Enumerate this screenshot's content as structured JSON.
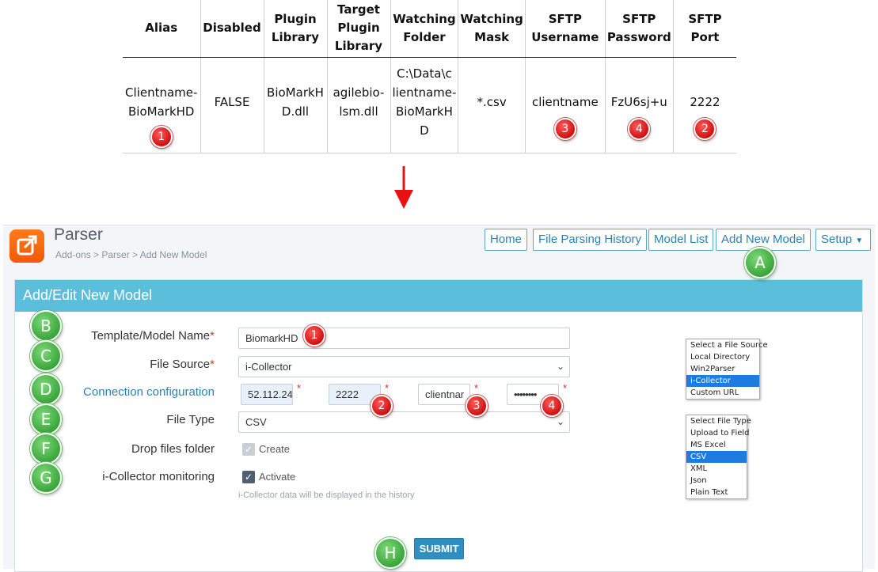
{
  "table": {
    "headers": [
      "Alias",
      "Disabled",
      "Plugin Library",
      "Target Plugin Library",
      "Watching Folder",
      "Watching Mask",
      "SFTP Username",
      "SFTP Password",
      "SFTP Port"
    ],
    "header_lines": [
      [
        "Alias"
      ],
      [
        "Disabled"
      ],
      [
        "Plugin",
        "Library"
      ],
      [
        "Target",
        "Plugin",
        "Library"
      ],
      [
        "Watching",
        "Folder"
      ],
      [
        "Watching",
        "Mask"
      ],
      [
        "SFTP",
        "Username"
      ],
      [
        "SFTP",
        "Password"
      ],
      [
        "SFTP Port"
      ]
    ],
    "row": [
      [
        "Clientname-",
        "BioMarkHD"
      ],
      [
        "FALSE"
      ],
      [
        "BioMarkH",
        "D.dll"
      ],
      [
        "agilebio-",
        "lsm.dll"
      ],
      [
        "C:\\Data\\c",
        "lientname-",
        "BioMarkH",
        "D"
      ],
      [
        "*.csv"
      ],
      [
        "clientname"
      ],
      [
        "FzU6sj+u"
      ],
      [
        "2222"
      ]
    ],
    "badges": {
      "alias": "1",
      "username": "3",
      "password": "4",
      "port": "2"
    }
  },
  "app": {
    "title": "Parser",
    "breadcrumb": "Add-ons > Parser > Add New Model",
    "nav": {
      "home": "Home",
      "history": "File Parsing History",
      "model_list": "Model List",
      "add_new": "Add New Model",
      "setup": "Setup"
    },
    "panel_title": "Add/Edit New Model",
    "labels": {
      "template": "Template/Model Name",
      "file_source": "File Source",
      "connection": "Connection configuration",
      "file_type": "File Type",
      "drop_folder": "Drop files folder",
      "monitoring": "i-Collector monitoring"
    },
    "values": {
      "template": "BiomarkHD",
      "file_source": "i-Collector",
      "host": "52.112.24",
      "port": "2222",
      "username": "clientnar",
      "password": "••••••••",
      "file_type": "CSV"
    },
    "checkboxes": {
      "create": "Create",
      "create_checked": true,
      "activate": "Activate",
      "activate_checked": true
    },
    "hint": "i-Collector data will be displayed in the history",
    "submit": "SUBMIT"
  },
  "dropdown_file_source": {
    "options": [
      "Select a File Source",
      "Local Directory",
      "Win2Parser",
      "i-Collector",
      "Custom URL"
    ],
    "selected": "i-Collector"
  },
  "dropdown_file_type": {
    "options": [
      "Select File Type",
      "Upload to Field",
      "MS Excel",
      "CSV",
      "XML",
      "Json",
      "Plain Text"
    ],
    "selected": "CSV"
  },
  "step_badges": [
    "A",
    "B",
    "C",
    "D",
    "E",
    "F",
    "G",
    "H"
  ],
  "form_badges": {
    "template": "1",
    "port": "2",
    "username": "3",
    "password": "4"
  },
  "colors": {
    "accent": "#5bbfdc",
    "nav_border": "#5aa7c7",
    "red": "#d01010",
    "green": "#3aa63a",
    "submit": "#2f8fc0"
  }
}
